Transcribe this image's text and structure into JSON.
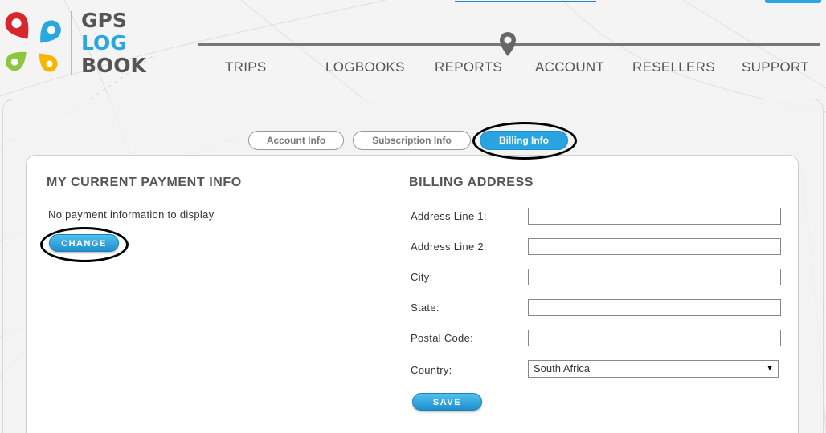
{
  "header": {
    "logo": {
      "line1": "GPS",
      "line2": "LOG",
      "line3": "BOOK"
    },
    "nav": [
      {
        "label": "TRIPS"
      },
      {
        "label": "LOGBOOKS"
      },
      {
        "label": "REPORTS"
      },
      {
        "label": "ACCOUNT"
      },
      {
        "label": "RESELLERS"
      },
      {
        "label": "SUPPORT"
      }
    ]
  },
  "tabs": [
    {
      "label": "Account Info",
      "active": false
    },
    {
      "label": "Subscription Info",
      "active": false
    },
    {
      "label": "Billing Info",
      "active": true
    }
  ],
  "payment": {
    "title": "MY CURRENT PAYMENT INFO",
    "message": "No payment information to display",
    "change_label": "CHANGE"
  },
  "billing": {
    "title": "BILLING ADDRESS",
    "fields": [
      {
        "label": "Address Line 1:",
        "value": ""
      },
      {
        "label": "Address Line 2:",
        "value": ""
      },
      {
        "label": "City:",
        "value": ""
      },
      {
        "label": "State:",
        "value": ""
      },
      {
        "label": "Postal Code:",
        "value": ""
      }
    ],
    "country_label": "Country:",
    "country_value": "South Africa",
    "save_label": "SAVE"
  },
  "colors": {
    "accent": "#29a4e1",
    "logo_red": "#d9262c",
    "logo_blue": "#2aa7e0",
    "logo_green": "#8cc63f",
    "logo_yellow": "#f7b500"
  }
}
